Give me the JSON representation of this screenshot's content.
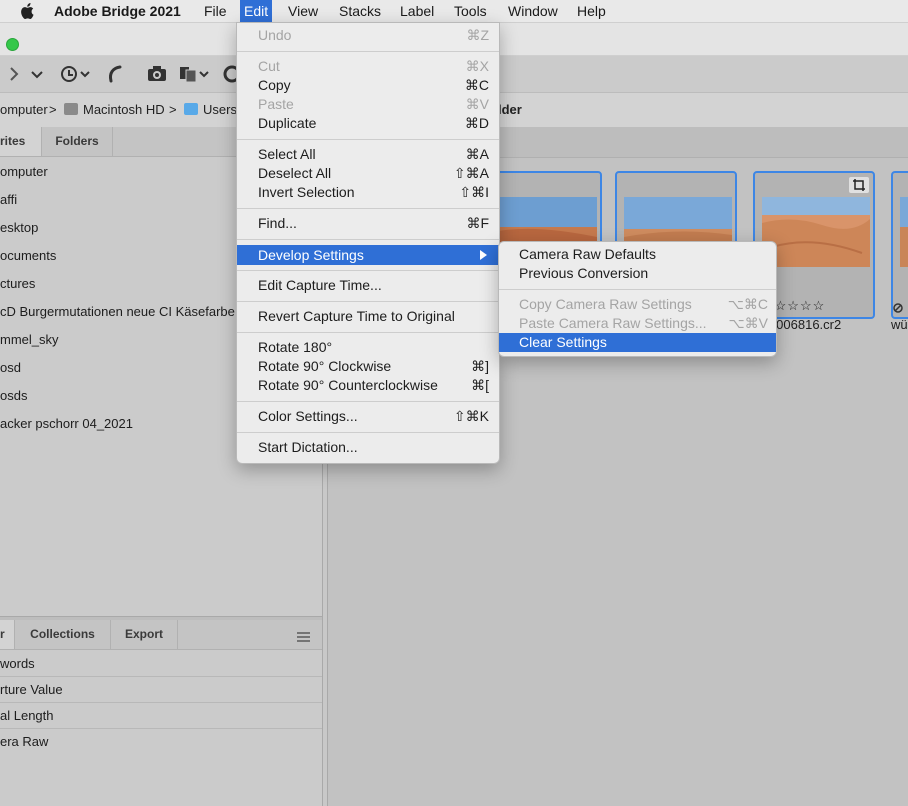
{
  "menubar": {
    "app_name": "Adobe Bridge 2021",
    "items": [
      "File",
      "Edit",
      "View",
      "Stacks",
      "Label",
      "Tools",
      "Window",
      "Help"
    ]
  },
  "toolbar": {
    "icons": [
      "forward-icon",
      "chevron-down-icon",
      "history-icon",
      "boomerang-icon",
      "camera-import-icon",
      "copy-files-icon",
      "rotate-icon"
    ]
  },
  "path_bar": {
    "crumbs": [
      "omputer",
      "Macintosh HD",
      "Users",
      "lder"
    ],
    "separator": ">"
  },
  "left_panel": {
    "top_tabs": [
      "rites",
      "Folders"
    ],
    "favorites": [
      "omputer",
      "affi",
      "esktop",
      "ocuments",
      "ctures",
      "cD Burgermutationen neue CI Käsefarbe C",
      "mmel_sky",
      "osd",
      "osds",
      "acker pschorr 04_2021"
    ],
    "bottom_tabs": [
      "r",
      "Collections",
      "Export"
    ],
    "metadata": [
      "words",
      "rture Value",
      "al Length",
      "era Raw"
    ]
  },
  "content": {
    "thumb_caption_rating": "☆☆☆☆☆",
    "thumb_caption_filename": "te-006816.cr2",
    "thumb_caption_partial": "wü"
  },
  "edit_menu": {
    "items": [
      {
        "label": "Undo",
        "shortcut": "⌘Z",
        "disabled": true
      },
      {
        "label": "Cut",
        "shortcut": "⌘X",
        "disabled": true
      },
      {
        "label": "Copy",
        "shortcut": "⌘C",
        "disabled": false
      },
      {
        "label": "Paste",
        "shortcut": "⌘V",
        "disabled": true
      },
      {
        "label": "Duplicate",
        "shortcut": "⌘D",
        "disabled": false
      },
      {
        "label": "Select All",
        "shortcut": "⌘A",
        "disabled": false
      },
      {
        "label": "Deselect All",
        "shortcut": "⇧⌘A",
        "disabled": false
      },
      {
        "label": "Invert Selection",
        "shortcut": "⇧⌘I",
        "disabled": false
      },
      {
        "label": "Find...",
        "shortcut": "⌘F",
        "disabled": false
      },
      {
        "label": "Develop Settings",
        "shortcut": "",
        "disabled": false,
        "highlighted": true
      },
      {
        "label": "Edit Capture Time...",
        "shortcut": "",
        "disabled": false
      },
      {
        "label": "Revert Capture Time to Original",
        "shortcut": "",
        "disabled": false
      },
      {
        "label": "Rotate 180°",
        "shortcut": "",
        "disabled": false
      },
      {
        "label": "Rotate 90° Clockwise",
        "shortcut": "⌘]",
        "disabled": false
      },
      {
        "label": "Rotate 90° Counterclockwise",
        "shortcut": "⌘[",
        "disabled": false
      },
      {
        "label": "Color Settings...",
        "shortcut": "⇧⌘K",
        "disabled": false
      },
      {
        "label": "Start Dictation...",
        "shortcut": "",
        "disabled": false
      }
    ]
  },
  "develop_submenu": {
    "items": [
      {
        "label": "Camera Raw Defaults",
        "shortcut": "",
        "disabled": false
      },
      {
        "label": "Previous Conversion",
        "shortcut": "",
        "disabled": false
      },
      {
        "label": "Copy Camera Raw Settings",
        "shortcut": "⌥⌘C",
        "disabled": true
      },
      {
        "label": "Paste Camera Raw Settings...",
        "shortcut": "⌥⌘V",
        "disabled": true
      },
      {
        "label": "Clear Settings",
        "shortcut": "",
        "disabled": false,
        "highlighted": true
      }
    ]
  },
  "colors": {
    "menu_highlight": "#2f6fd6",
    "selection_border": "#3d86e5",
    "window_zoom_button": "#34c84a"
  }
}
